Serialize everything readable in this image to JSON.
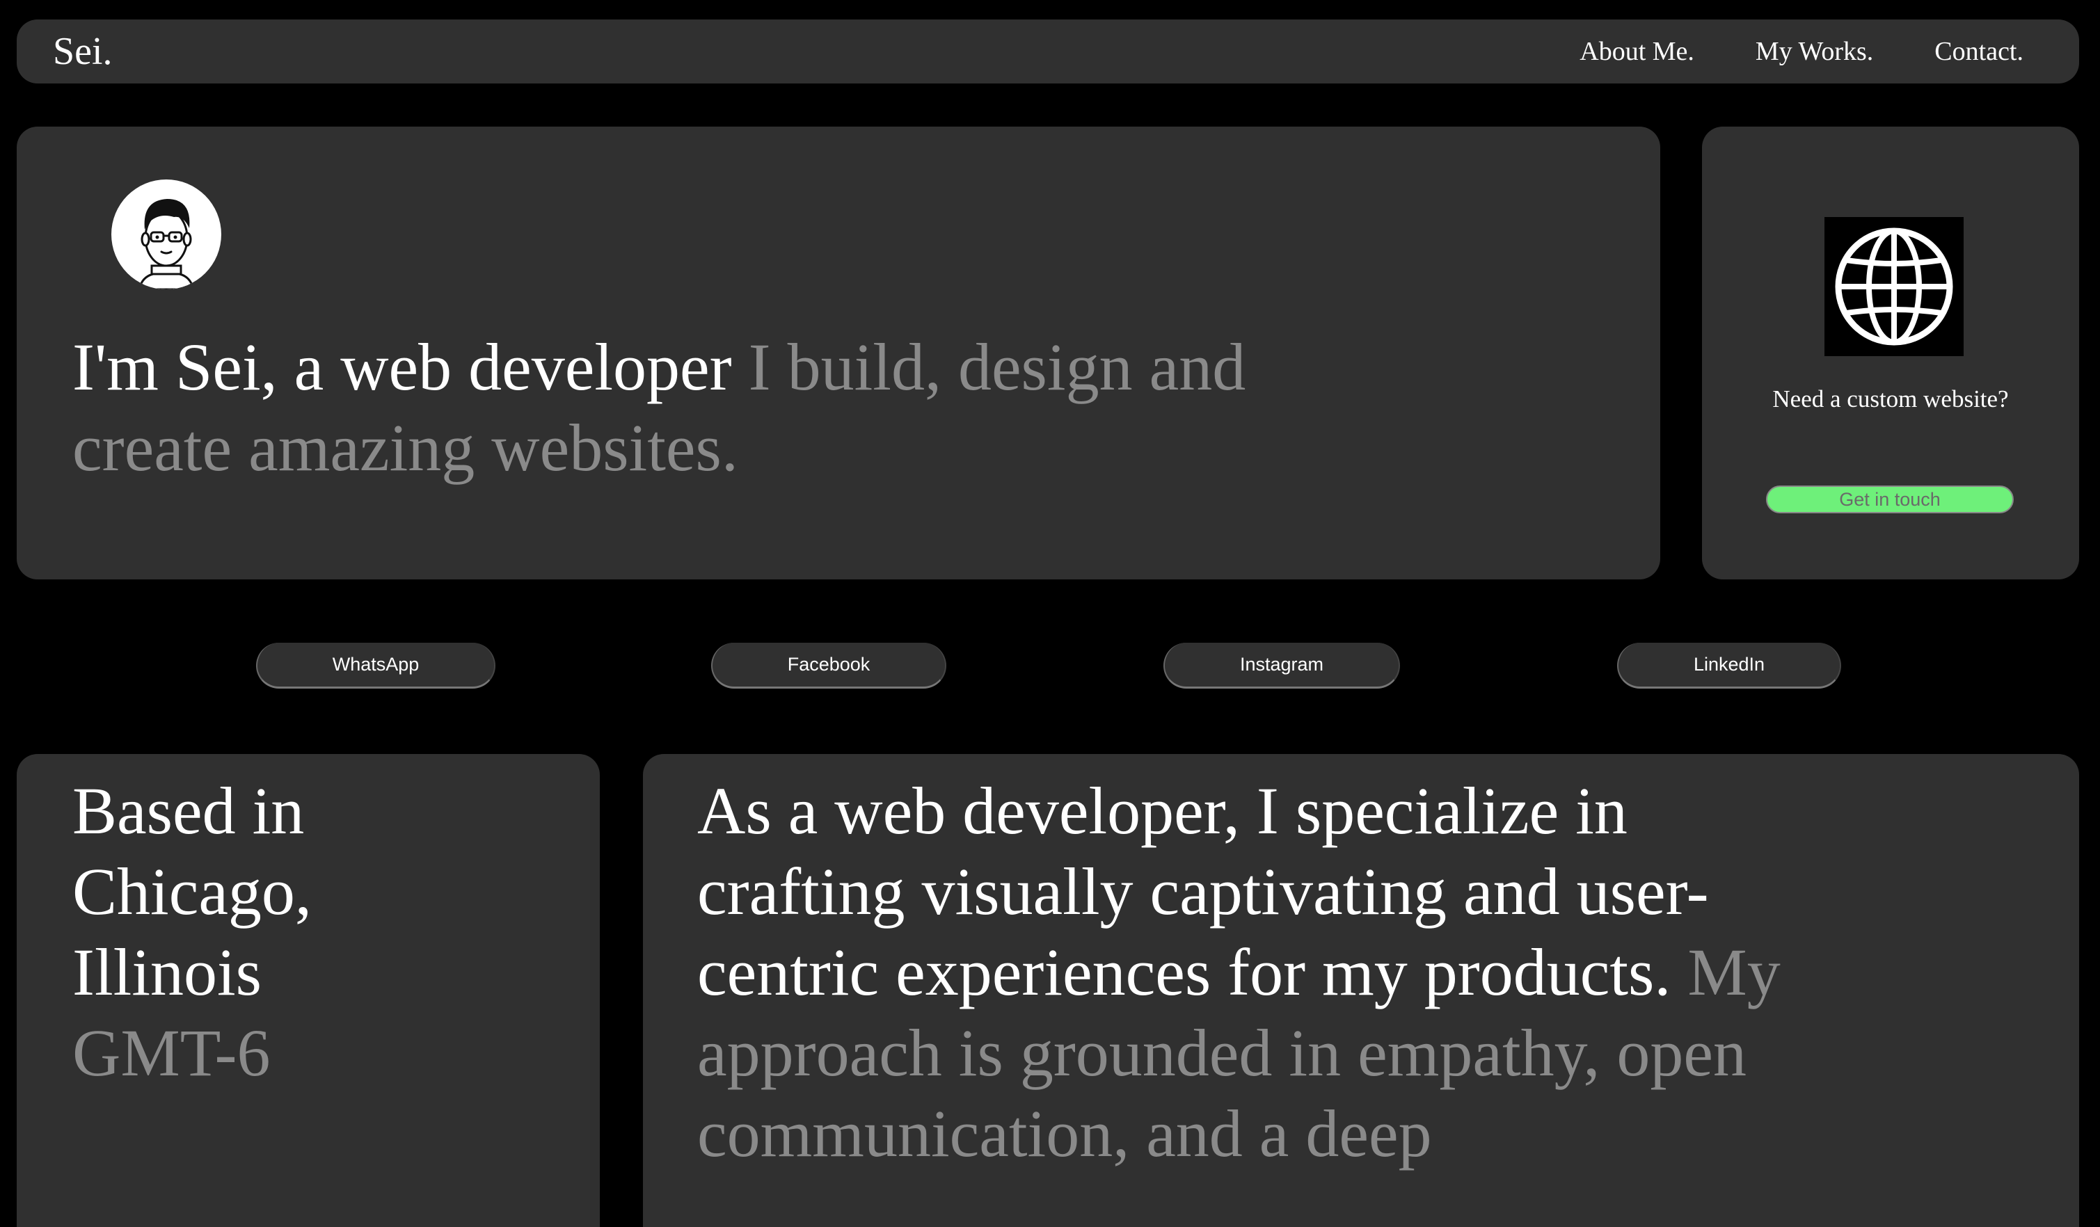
{
  "nav": {
    "logo": "Sei.",
    "links": [
      "About Me.",
      "My Works.",
      "Contact."
    ]
  },
  "hero": {
    "headline_main": "I'm Sei, a web developer",
    "headline_dim": "I build, design and create amazing websites.",
    "avatar_icon": "developer-avatar-icon"
  },
  "cta": {
    "icon": "globe-icon",
    "question": "Need a custom website?",
    "button": "Get in touch",
    "button_color": "#6ef07a"
  },
  "social": {
    "buttons": [
      "WhatsApp",
      "Facebook",
      "Instagram",
      "LinkedIn"
    ]
  },
  "location": {
    "line1": "Based in",
    "line2": "Chicago,",
    "line3": "Illinois",
    "timezone": "GMT-6"
  },
  "about": {
    "main": "As a web developer, I specialize in crafting visually captivating and user-centric experiences for my products.",
    "dim": "My approach is grounded in empathy, open communication, and a deep"
  },
  "colors": {
    "background": "#000000",
    "card": "#303030",
    "dim_text": "#8a8a8a",
    "accent": "#6ef07a"
  }
}
